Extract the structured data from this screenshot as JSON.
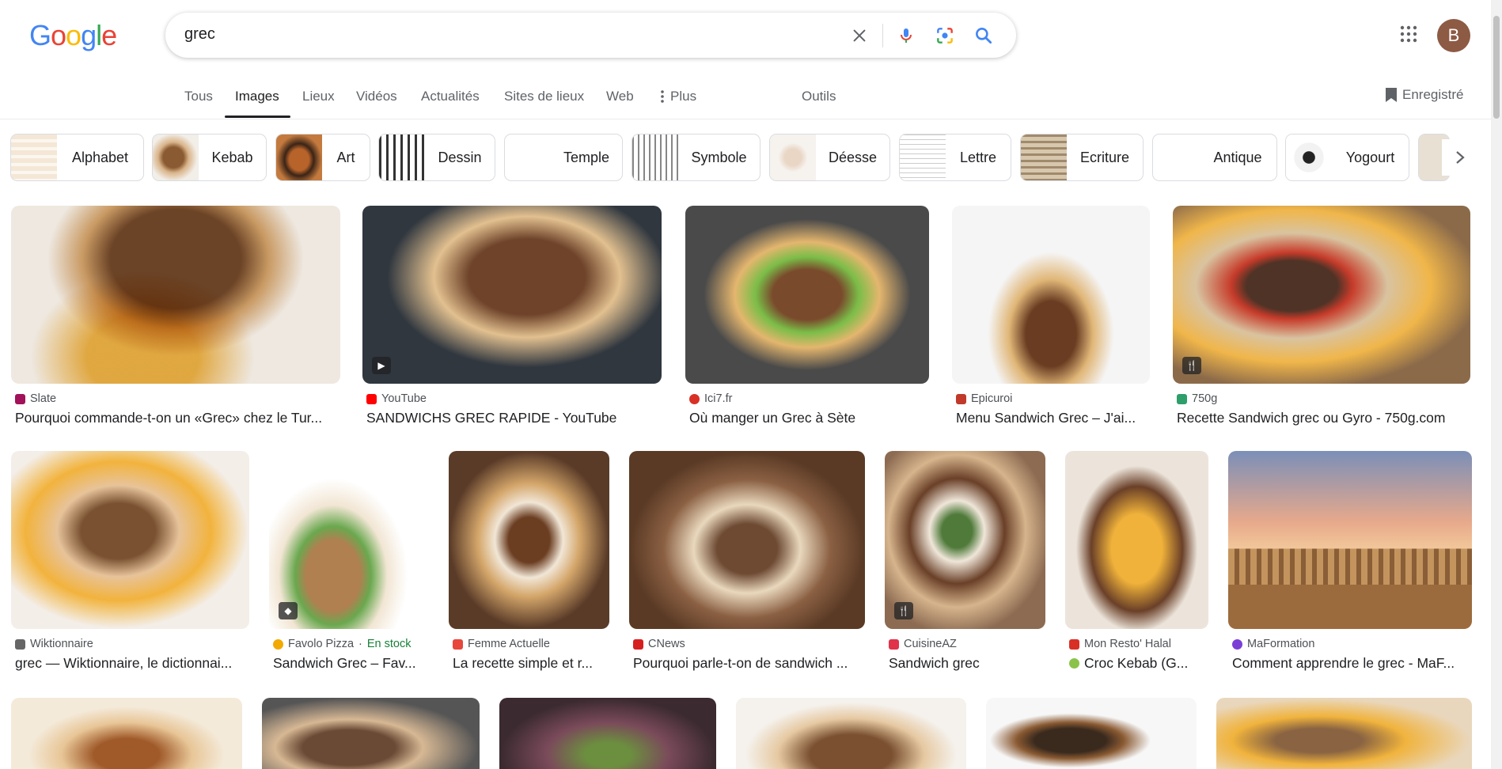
{
  "logo": {
    "text": "Google"
  },
  "search": {
    "query": "grec"
  },
  "avatar": {
    "initial": "B"
  },
  "tabs": [
    {
      "label": "Tous"
    },
    {
      "label": "Images"
    },
    {
      "label": "Lieux"
    },
    {
      "label": "Vidéos"
    },
    {
      "label": "Actualités"
    },
    {
      "label": "Sites de lieux"
    },
    {
      "label": "Web"
    },
    {
      "label": "Plus"
    },
    {
      "label": "Outils"
    }
  ],
  "saved": {
    "label": "Enregistré"
  },
  "chips": [
    {
      "label": "Alphabet"
    },
    {
      "label": "Kebab"
    },
    {
      "label": "Art"
    },
    {
      "label": "Dessin"
    },
    {
      "label": "Temple"
    },
    {
      "label": "Symbole"
    },
    {
      "label": "Déesse"
    },
    {
      "label": "Lettre"
    },
    {
      "label": "Ecriture"
    },
    {
      "label": "Antique"
    },
    {
      "label": "Yogourt"
    }
  ],
  "results": [
    {
      "source": "Slate",
      "title": "Pourquoi commande-t-on un «Grec» chez le Tur...",
      "icon": "",
      "color": "#a1125a"
    },
    {
      "source": "YouTube",
      "title": "SANDWICHS GREC RAPIDE - YouTube",
      "icon": "play-icon",
      "color": "#ff0000"
    },
    {
      "source": "Ici7.fr",
      "title": "Où manger un Grec à Sète",
      "icon": "",
      "color": "#d93025"
    },
    {
      "source": "Epicuroi",
      "title": "Menu Sandwich Grec – J'ai...",
      "icon": "",
      "color": "#c0392b"
    },
    {
      "source": "750g",
      "title": "Recette Sandwich grec ou Gyro - 750g.com",
      "icon": "recipe-icon",
      "color": "#2e9e6b"
    },
    {
      "source": "Wiktionnaire",
      "title": "grec — Wiktionnaire, le dictionnai...",
      "icon": "",
      "color": "#666666"
    },
    {
      "source": "Favolo Pizza",
      "extra": "En stock",
      "title": "Sandwich Grec – Fav...",
      "icon": "tag-icon",
      "color": "#f2a900"
    },
    {
      "source": "Femme Actuelle",
      "title": "La recette simple et r...",
      "icon": "",
      "color": "#e8473c"
    },
    {
      "source": "CNews",
      "title": "Pourquoi parle-t-on de sandwich ...",
      "icon": "",
      "color": "#d62020"
    },
    {
      "source": "CuisineAZ",
      "title": "Sandwich grec",
      "icon": "recipe-icon",
      "color": "#e0344a"
    },
    {
      "source": "Mon Resto' Halal",
      "title": "Croc Kebab (G...",
      "icon": "",
      "color": "#d93025"
    },
    {
      "source": "MaFormation",
      "title": "Comment apprendre le grec - MaF...",
      "icon": "",
      "color": "#7b3fd6"
    }
  ]
}
